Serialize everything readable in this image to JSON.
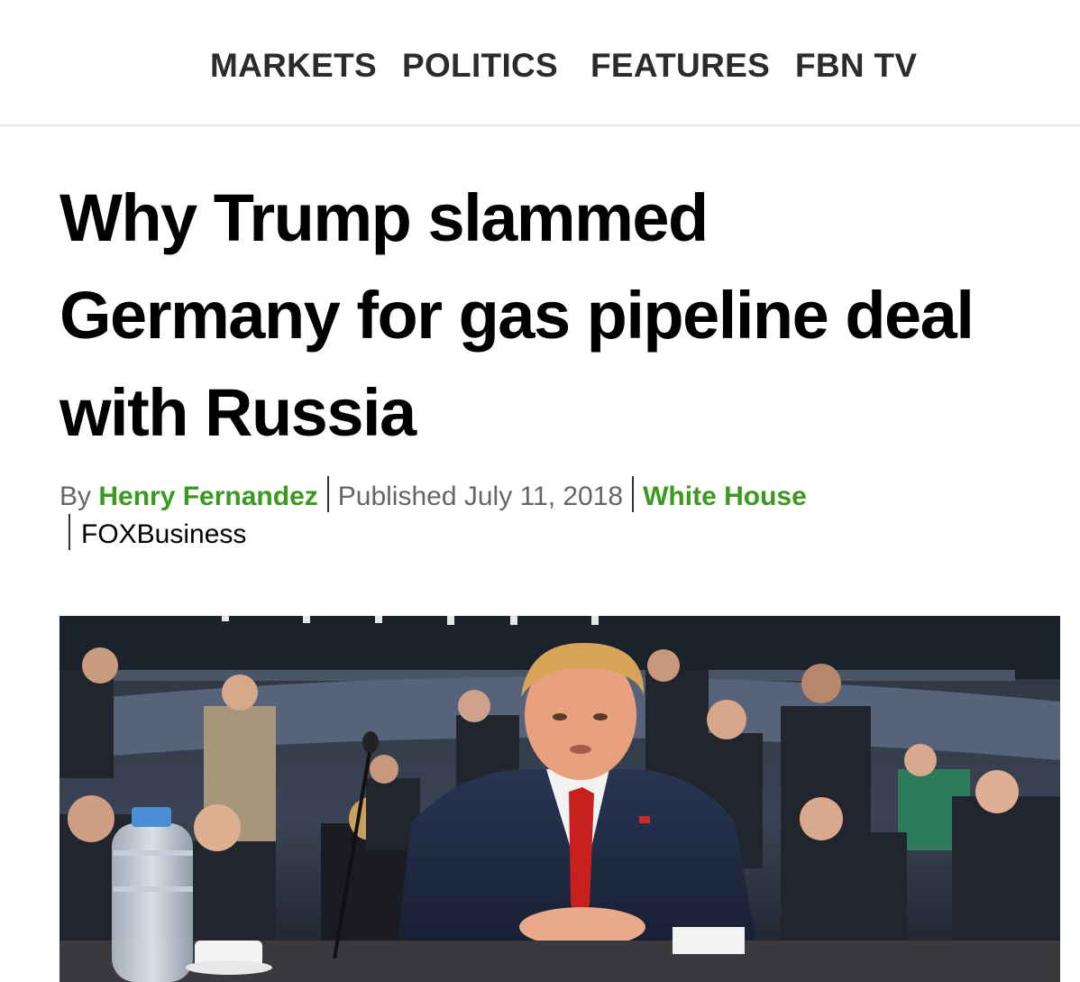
{
  "nav": {
    "items": [
      "MARKETS",
      "POLITICS",
      "FEATURES",
      "FBN TV"
    ]
  },
  "article": {
    "headline_lines": [
      "Why Trump slammed",
      "Germany for gas pipeline deal",
      "with Russia"
    ],
    "byline_prefix": "By",
    "author": "Henry Fernandez",
    "published": "Published July 11, 2018",
    "category": "White House",
    "source": "FOXBusiness"
  },
  "photo": {
    "description_icon": "photo-icon"
  },
  "colors": {
    "link_green": "#3a9a1f",
    "headline": "#000000",
    "nav_text": "#2b2b2b",
    "byline_gray": "#666666"
  }
}
